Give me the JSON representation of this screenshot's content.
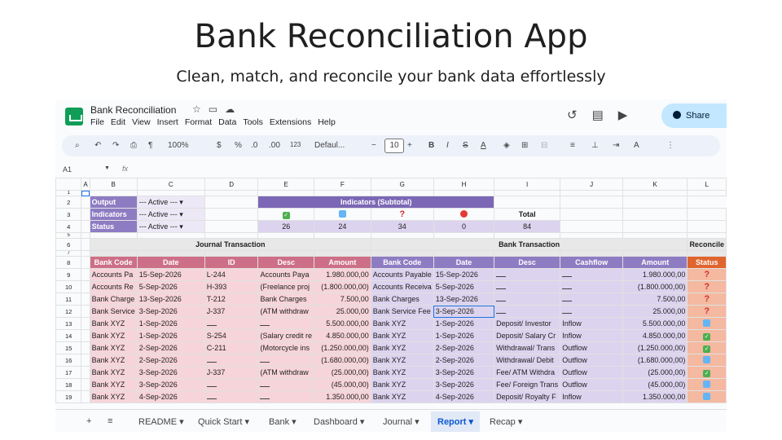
{
  "hero": {
    "title": "Bank Reconciliation App",
    "subtitle": "Clean, match, and reconcile your bank data effortlessly"
  },
  "titlebar": {
    "doc_title": "Bank Reconciliation",
    "menu": [
      "File",
      "Edit",
      "View",
      "Insert",
      "Format",
      "Data",
      "Tools",
      "Extensions",
      "Help"
    ],
    "share_label": "Share"
  },
  "toolbar": {
    "zoom": "100%",
    "currency": "$",
    "percent": "%",
    "dec_decrease": ".0",
    "dec_increase": ".00",
    "number_format": "123",
    "font": "Defaul...",
    "font_size": "10",
    "bold": "B",
    "italic": "I"
  },
  "formula_bar": {
    "cell_ref": "A1",
    "fx": "fx"
  },
  "columns": [
    "A",
    "B",
    "C",
    "D",
    "E",
    "F",
    "G",
    "H",
    "I",
    "J",
    "K",
    "L"
  ],
  "filters": [
    {
      "label": "Output",
      "value": "--- Active ---"
    },
    {
      "label": "Indicators",
      "value": "--- Active ---"
    },
    {
      "label": "Status",
      "value": "--- Active ---"
    }
  ],
  "indicators": {
    "title": "Indicators (Subtotal)",
    "total_label": "Total",
    "counts": [
      "26",
      "24",
      "34",
      "0"
    ],
    "total": "84"
  },
  "sections": {
    "journal": "Journal Transaction",
    "bank": "Bank Transaction",
    "reconcile": "Reconcile"
  },
  "headers": {
    "journal": [
      "Bank Code",
      "Date",
      "ID",
      "Desc",
      "Amount"
    ],
    "bank": [
      "Bank Code",
      "Date",
      "Desc",
      "Cashflow",
      "Amount"
    ],
    "status": "Status"
  },
  "rows": [
    {
      "n": "9",
      "jcode": "Accounts Pa",
      "jdate": "15-Sep-2026",
      "jid": "L-244",
      "jdesc": "Accounts Paya",
      "jamt": "1.980.000,00",
      "bcode": "Accounts Payable",
      "bdate": "15-Sep-2026",
      "bdesc": "",
      "bcash": "",
      "bamt": "1.980.000,00",
      "status": "q"
    },
    {
      "n": "10",
      "jcode": "Accounts Re",
      "jdate": "5-Sep-2026",
      "jid": "H-393",
      "jdesc": "(Freelance proj",
      "jamt": "(1.800.000,00)",
      "bcode": "Accounts Receiva",
      "bdate": "5-Sep-2026",
      "bdesc": "",
      "bcash": "",
      "bamt": "(1.800.000,00)",
      "status": "q"
    },
    {
      "n": "11",
      "jcode": "Bank Charge",
      "jdate": "13-Sep-2026",
      "jid": "T-212",
      "jdesc": "Bank Charges",
      "jamt": "7.500,00",
      "bcode": "Bank Charges",
      "bdate": "13-Sep-2026",
      "bdesc": "",
      "bcash": "",
      "bamt": "7.500,00",
      "status": "q"
    },
    {
      "n": "12",
      "jcode": "Bank Service",
      "jdate": "3-Sep-2026",
      "jid": "J-337",
      "jdesc": "(ATM withdraw",
      "jamt": "25.000,00",
      "bcode": "Bank Service Fee",
      "bdate": "3-Sep-2026",
      "bdesc": "",
      "bcash": "",
      "bamt": "25.000,00",
      "status": "q"
    },
    {
      "n": "13",
      "jcode": "Bank XYZ",
      "jdate": "1-Sep-2026",
      "jid": "",
      "jdesc": "",
      "jamt": "5.500.000,00",
      "bcode": "Bank XYZ",
      "bdate": "1-Sep-2026",
      "bdesc": "Deposit/ Investor",
      "bcash": "Inflow",
      "bamt": "5.500.000,00",
      "status": "b"
    },
    {
      "n": "14",
      "jcode": "Bank XYZ",
      "jdate": "1-Sep-2026",
      "jid": "S-254",
      "jdesc": "(Salary credit re",
      "jamt": "4.850.000,00",
      "bcode": "Bank XYZ",
      "bdate": "1-Sep-2026",
      "bdesc": "Deposit/ Salary Cr",
      "bcash": "Inflow",
      "bamt": "4.850.000,00",
      "status": "c"
    },
    {
      "n": "15",
      "jcode": "Bank XYZ",
      "jdate": "2-Sep-2026",
      "jid": "C-211",
      "jdesc": "(Motorcycle ins",
      "jamt": "(1.250.000,00)",
      "bcode": "Bank XYZ",
      "bdate": "2-Sep-2026",
      "bdesc": "Withdrawal/ Trans",
      "bcash": "Outflow",
      "bamt": "(1.250.000,00)",
      "status": "c"
    },
    {
      "n": "16",
      "jcode": "Bank XYZ",
      "jdate": "2-Sep-2026",
      "jid": "",
      "jdesc": "",
      "jamt": "(1.680.000,00)",
      "bcode": "Bank XYZ",
      "bdate": "2-Sep-2026",
      "bdesc": "Withdrawal/ Debit",
      "bcash": "Outflow",
      "bamt": "(1.680.000,00)",
      "status": "b"
    },
    {
      "n": "17",
      "jcode": "Bank XYZ",
      "jdate": "3-Sep-2026",
      "jid": "J-337",
      "jdesc": "(ATM withdraw",
      "jamt": "(25.000,00)",
      "bcode": "Bank XYZ",
      "bdate": "3-Sep-2026",
      "bdesc": "Fee/ ATM Withdra",
      "bcash": "Outflow",
      "bamt": "(25.000,00)",
      "status": "c"
    },
    {
      "n": "18",
      "jcode": "Bank XYZ",
      "jdate": "3-Sep-2026",
      "jid": "",
      "jdesc": "",
      "jamt": "(45.000,00)",
      "bcode": "Bank XYZ",
      "bdate": "3-Sep-2026",
      "bdesc": "Fee/ Foreign Trans",
      "bcash": "Outflow",
      "bamt": "(45.000,00)",
      "status": "b"
    },
    {
      "n": "19",
      "jcode": "Bank XYZ",
      "jdate": "4-Sep-2026",
      "jid": "",
      "jdesc": "",
      "jamt": "1.350.000,00",
      "bcode": "Bank XYZ",
      "bdate": "4-Sep-2026",
      "bdesc": "Deposit/ Royalty F",
      "bcash": "Inflow",
      "bamt": "1.350.000,00",
      "status": "b"
    }
  ],
  "sheet_tabs": [
    "README",
    "Quick Start",
    "Bank",
    "Dashboard",
    "Journal",
    "Report",
    "Recap"
  ],
  "active_tab": "Report"
}
